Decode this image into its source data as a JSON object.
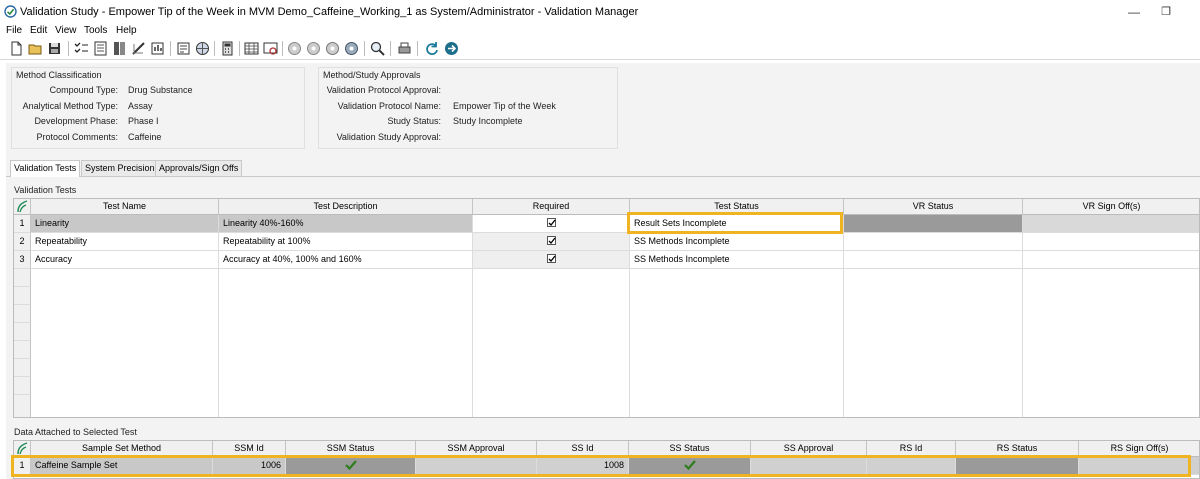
{
  "window": {
    "title": "Validation Study - Empower Tip of the Week in MVM Demo_Caffeine_Working_1 as System/Administrator - Validation Manager",
    "minimize_glyph": "—",
    "maximize_glyph": "❐"
  },
  "menu": [
    "File",
    "Edit",
    "View",
    "Tools",
    "Help"
  ],
  "toolbar_icons": [
    "new-icon",
    "open-icon",
    "save-icon",
    "checklist-icon",
    "document-list-icon",
    "book-icon",
    "ruler-icon",
    "report-icon",
    "globe-icon",
    "calculator-icon",
    "table-icon",
    "preview-icon",
    "disc-icon-1",
    "disc-icon-2",
    "disc-icon-3",
    "disc-icon-4",
    "magnify-icon",
    "print-icon",
    "refresh-icon",
    "arrow-icon"
  ],
  "method_classification": {
    "title": "Method Classification",
    "fields": [
      {
        "label": "Compound Type:",
        "value": "Drug Substance"
      },
      {
        "label": "Analytical Method Type:",
        "value": "Assay"
      },
      {
        "label": "Development Phase:",
        "value": "Phase I"
      },
      {
        "label": "Protocol Comments:",
        "value": "Caffeine"
      }
    ]
  },
  "approvals": {
    "title": "Method/Study Approvals",
    "fields": [
      {
        "label": "Validation Protocol Approval:",
        "value": ""
      },
      {
        "label": "Validation Protocol Name:",
        "value": "Empower Tip of the Week"
      },
      {
        "label": "Study Status:",
        "value": "Study Incomplete"
      },
      {
        "label": "Validation Study Approval:",
        "value": ""
      }
    ]
  },
  "tabs": [
    "Validation Tests",
    "System Precision",
    "Approvals/Sign Offs"
  ],
  "validation_tests": {
    "label": "Validation Tests",
    "columns": [
      "Test Name",
      "Test Description",
      "Required",
      "Test Status",
      "VR Status",
      "VR Sign Off(s)"
    ],
    "rows": [
      {
        "num": "1",
        "name": "Linearity",
        "description": "Linearity 40%-160%",
        "required": true,
        "status": "Result Sets Incomplete",
        "vr_status": "",
        "vr_signoff": ""
      },
      {
        "num": "2",
        "name": "Repeatability",
        "description": "Repeatability at 100%",
        "required": true,
        "status": "SS Methods Incomplete",
        "vr_status": "",
        "vr_signoff": ""
      },
      {
        "num": "3",
        "name": "Accuracy",
        "description": "Accuracy at 40%, 100% and 160%",
        "required": true,
        "status": "SS Methods Incomplete",
        "vr_status": "",
        "vr_signoff": ""
      }
    ]
  },
  "attached_data": {
    "label": "Data Attached to Selected Test",
    "columns": [
      "Sample Set Method",
      "SSM Id",
      "SSM Status",
      "SSM Approval",
      "SS Id",
      "SS Status",
      "SS Approval",
      "RS Id",
      "RS Status",
      "RS Sign Off(s)"
    ],
    "rows": [
      {
        "num": "1",
        "ssm": "Caffeine Sample Set",
        "ssm_id": "1006",
        "ss_id": "1008"
      }
    ]
  },
  "colors": {
    "highlight": "#f0b321",
    "selected_row": "#c8c8c8",
    "dark_cell": "#9a9a9a",
    "check_green": "#2d7d1e"
  }
}
